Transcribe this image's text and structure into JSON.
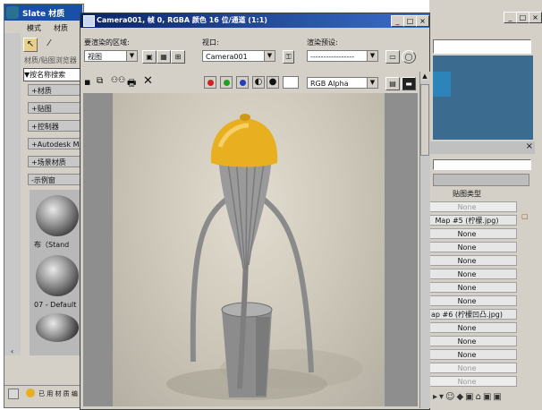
{
  "slate_window": {
    "title": "Slate 材质",
    "menu": [
      "模式",
      "材质"
    ],
    "browser_tabs": [
      "材质/贴图浏览器"
    ],
    "search_label": "按名称搜索",
    "rollouts": [
      "+材质",
      "+贴图",
      "+控制器",
      "+Autodesk M",
      "+场景材质",
      "-示例窗"
    ],
    "samples": [
      {
        "label": "布（Stand"
      },
      {
        "label": "07 - Default"
      }
    ],
    "bottom_label": "已 用 材 质 编 辑 器"
  },
  "right_panel": {
    "title_controls": [
      "_",
      "□",
      "×"
    ],
    "close": "×",
    "column_header": "贴图类型",
    "maps": [
      {
        "label": "None",
        "dim": true
      },
      {
        "label": "Map #5 (柠檬.jpg)",
        "dim": false
      },
      {
        "label": "None",
        "dim": false
      },
      {
        "label": "None",
        "dim": false
      },
      {
        "label": "None",
        "dim": false
      },
      {
        "label": "None",
        "dim": false
      },
      {
        "label": "None",
        "dim": false
      },
      {
        "label": "None",
        "dim": false
      },
      {
        "label": "ap #6 (柠檬凹凸.jpg)",
        "dim": false
      },
      {
        "label": "None",
        "dim": false
      },
      {
        "label": "None",
        "dim": false
      },
      {
        "label": "None",
        "dim": false
      },
      {
        "label": "None",
        "dim": true
      },
      {
        "label": "None",
        "dim": true
      }
    ]
  },
  "render_window": {
    "title": "Camera001, 帧 0, RGBA 颜色 16 位/通道 (1:1)",
    "title_controls": [
      "_",
      "□",
      "×"
    ],
    "area_label": "要渲染的区域:",
    "area_value": "视图",
    "viewport_label": "视口:",
    "viewport_value": "Camera001",
    "preset_label": "渲染预设:",
    "preset_value": "-----------------",
    "channel_value": "RGB Alpha",
    "channel_colors": {
      "red": "#d02020",
      "green": "#20a020",
      "blue": "#2040c0"
    }
  },
  "colors": {
    "title_bar": "#1a4fa8",
    "window_bg": "#d4d0c8",
    "render_bg": "#c8c4b8",
    "lemon": "#e8b020"
  }
}
